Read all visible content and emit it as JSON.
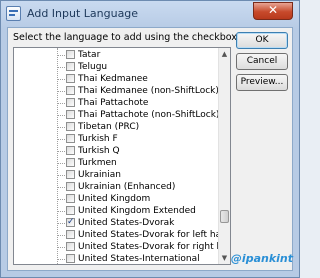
{
  "window": {
    "title": "Add Input Language",
    "close_glyph": "✕"
  },
  "instruction": "Select the language to add using the checkboxes below.",
  "languages": [
    {
      "label": "Tatar",
      "checked": false
    },
    {
      "label": "Telugu",
      "checked": false
    },
    {
      "label": "Thai Kedmanee",
      "checked": false
    },
    {
      "label": "Thai Kedmanee (non-ShiftLock)",
      "checked": false
    },
    {
      "label": "Thai Pattachote",
      "checked": false
    },
    {
      "label": "Thai Pattachote (non-ShiftLock)",
      "checked": false
    },
    {
      "label": "Tibetan (PRC)",
      "checked": false
    },
    {
      "label": "Turkish F",
      "checked": false
    },
    {
      "label": "Turkish Q",
      "checked": false
    },
    {
      "label": "Turkmen",
      "checked": false
    },
    {
      "label": "Ukrainian",
      "checked": false
    },
    {
      "label": "Ukrainian (Enhanced)",
      "checked": false
    },
    {
      "label": "United Kingdom",
      "checked": false
    },
    {
      "label": "United Kingdom Extended",
      "checked": false
    },
    {
      "label": "United States-Dvorak",
      "checked": true
    },
    {
      "label": "United States-Dvorak for left hand",
      "checked": false
    },
    {
      "label": "United States-Dvorak for right hand",
      "checked": false
    },
    {
      "label": "United States-International",
      "checked": false
    }
  ],
  "buttons": {
    "ok": "OK",
    "cancel": "Cancel",
    "preview": "Preview..."
  },
  "scrollbar": {
    "up_glyph": "▲",
    "down_glyph": "▼"
  },
  "watermark": "@ipankint",
  "colors": {
    "accent": "#2a8fd6",
    "close": "#c74a2c"
  }
}
